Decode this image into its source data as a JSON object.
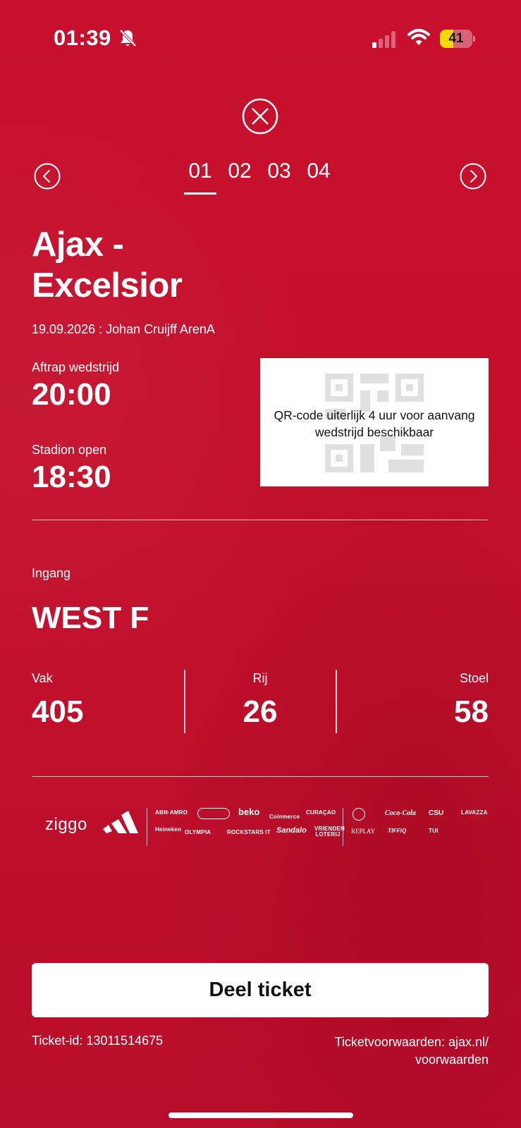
{
  "status_bar": {
    "time": "01:39",
    "battery_level": 41,
    "battery_text": "41",
    "battery_color": "#f5d90a",
    "icons": [
      "bell-slash-icon",
      "cellular-signal-icon",
      "wifi-icon",
      "battery-icon"
    ]
  },
  "navigation": {
    "close_icon": "close-circle-x-icon",
    "prev_icon": "chevron-left-circle-icon",
    "next_icon": "chevron-right-circle-icon",
    "tabs": [
      {
        "label": "01",
        "active": true
      },
      {
        "label": "02",
        "active": false
      },
      {
        "label": "03",
        "active": false
      },
      {
        "label": "04",
        "active": false
      }
    ]
  },
  "match": {
    "title_line1": "Ajax -",
    "title_line2": "Excelsior",
    "date_venue": "19.09.2026 : Johan Cruijff ArenA",
    "kickoff_label": "Aftrap wedstrijd",
    "kickoff_time": "20:00",
    "stadium_open_label": "Stadion open",
    "stadium_open_time": "18:30",
    "qr_message": "QR-code uiterlijk 4 uur voor aanvang wedstrijd beschikbaar"
  },
  "seat": {
    "entrance_label": "Ingang",
    "entrance_value": "WEST F",
    "section_label": "Vak",
    "section_value": "405",
    "row_label": "Rij",
    "row_value": "26",
    "seat_label": "Stoel",
    "seat_value": "58"
  },
  "sponsors": {
    "ziggo": "ziggo",
    "adidas_icon": "adidas-logo-icon",
    "row1": [
      "ABN·AMRO",
      "beko",
      "Coinmerce",
      "CURAÇAO"
    ],
    "row2": [
      "OLYMPIA",
      "ROCKSTARS IT",
      "Sandalo",
      "VRIENDEN LOTERIJ"
    ],
    "right_row1": [
      "Coca-Cola",
      "CSU",
      "LAVAZZA"
    ],
    "right_row2": [
      "REPLAY",
      "TIFFIQ",
      "TUI"
    ],
    "heineken": "Heineken"
  },
  "actions": {
    "share_label": "Deel ticket"
  },
  "footer": {
    "ticket_id": "Ticket-id: 13011514675",
    "terms_line1": "Ticketvoorwaarden: ajax.nl/",
    "terms_line2": "voorwaarden"
  },
  "colors": {
    "background": "#c8102e",
    "text": "#ffffff",
    "button_bg": "#ffffff",
    "button_text": "#111111"
  }
}
